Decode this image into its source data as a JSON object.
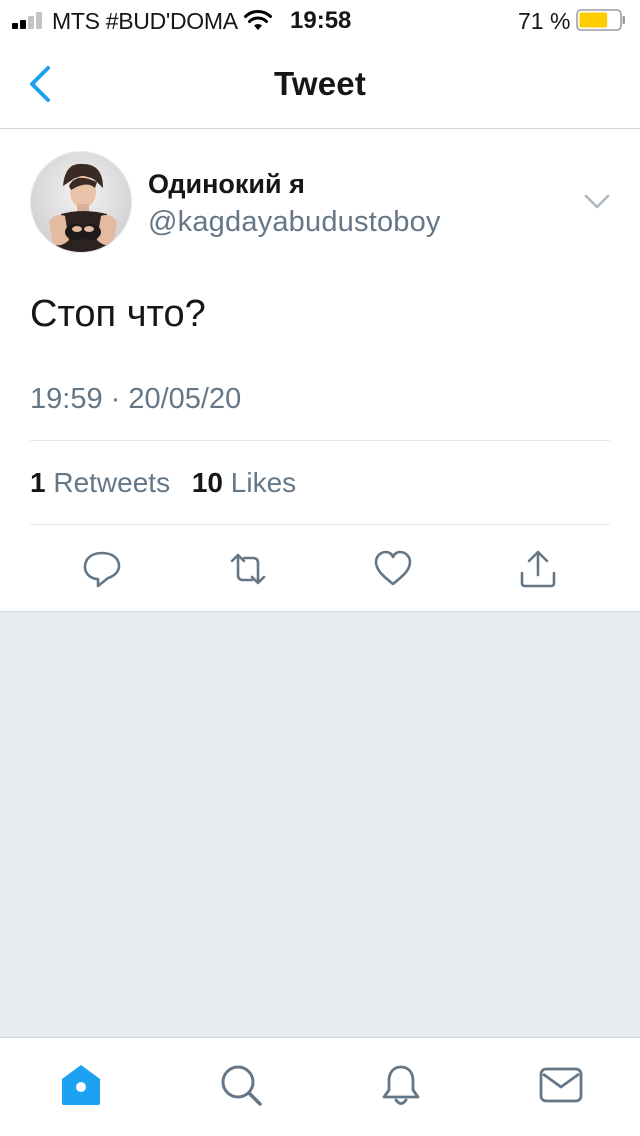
{
  "status_bar": {
    "carrier": "MTS #BUD'DOMA",
    "time": "19:58",
    "battery": "71 %",
    "battery_level": 0.71,
    "battery_color": "#ffcc00"
  },
  "nav": {
    "title": "Tweet",
    "back_icon": "chevron-left-icon"
  },
  "tweet": {
    "author_name": "Одинокий я",
    "author_handle": "@kagdayabudustoboy",
    "text": "Стоп что?",
    "timestamp": "19:59 · 20/05/20",
    "retweets_count": "1",
    "retweets_label": "Retweets",
    "likes_count": "10",
    "likes_label": "Likes",
    "actions": [
      "reply-icon",
      "retweet-icon",
      "like-icon",
      "share-icon"
    ]
  },
  "tabbar": {
    "tabs": [
      "home-icon",
      "search-icon",
      "notifications-icon",
      "messages-icon"
    ],
    "active": "home-icon"
  },
  "colors": {
    "accent": "#1da1f2",
    "secondary_text": "#657786",
    "icon": "#657786",
    "background": "#e6ecf0"
  }
}
